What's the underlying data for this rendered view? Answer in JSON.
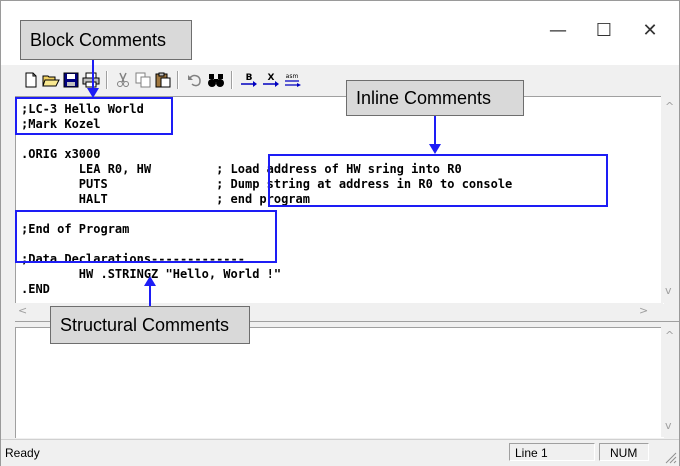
{
  "window": {
    "minimize_glyph": "—",
    "maximize_glyph": "☐",
    "close_glyph": "✕"
  },
  "toolbar": {
    "buttons": [
      "new-file",
      "open-folder",
      "save",
      "print",
      "cut",
      "copy",
      "paste",
      "undo",
      "find",
      "build",
      "execute",
      "assemble"
    ],
    "build_label": "B",
    "execute_label": "X",
    "assemble_label": "asm"
  },
  "editor": {
    "lines": [
      ";LC-3 Hello World",
      ";Mark Kozel",
      "",
      ".ORIG x3000",
      "        LEA R0, HW         ; Load address of HW sring into R0",
      "        PUTS               ; Dump string at address in R0 to console",
      "        HALT               ; end program",
      "",
      ";End of Program",
      "",
      ";Data Declarations-------------",
      "        HW .STRINGZ \"Hello, World !\"",
      ".END"
    ]
  },
  "annotations": {
    "block_comments": "Block Comments",
    "inline_comments": "Inline Comments",
    "structural_comments": "Structural Comments"
  },
  "statusbar": {
    "ready": "Ready",
    "line": "Line 1",
    "num": "NUM"
  },
  "colors": {
    "annotation_blue": "#1d1df5",
    "callout_gray": "#d9d9d9"
  }
}
